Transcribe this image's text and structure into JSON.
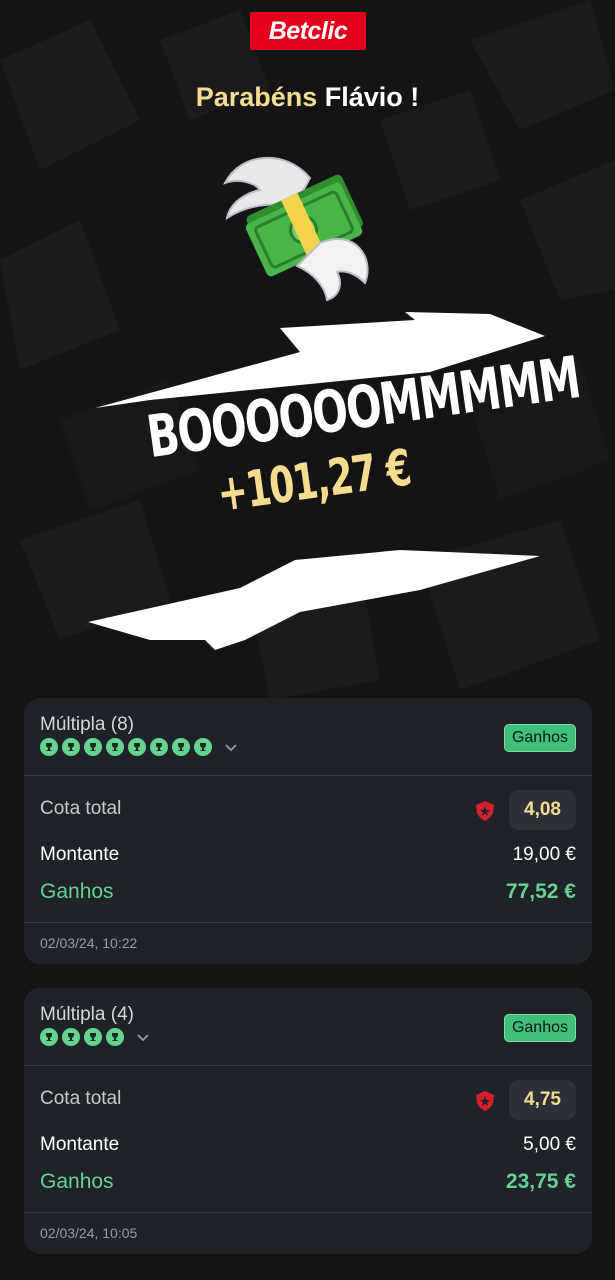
{
  "brand": {
    "logo_text": "Betclic",
    "color": "#e3001b"
  },
  "greeting": {
    "prefix": "Parabéns",
    "name": "Flávio !"
  },
  "celebration": {
    "headline": "BOOOOOOMMMMM",
    "amount": "+101,27 €"
  },
  "bets": [
    {
      "title": "Múltipla (8)",
      "selections_won": 8,
      "status": "Ganhos",
      "cota_label": "Cota total",
      "cota_value": "4,08",
      "montante_label": "Montante",
      "montante_value": "19,00 €",
      "ganhos_label": "Ganhos",
      "ganhos_value": "77,52 €",
      "timestamp": "02/03/24, 10:22"
    },
    {
      "title": "Múltipla (4)",
      "selections_won": 4,
      "status": "Ganhos",
      "cota_label": "Cota total",
      "cota_value": "4,75",
      "montante_label": "Montante",
      "montante_value": "5,00 €",
      "ganhos_label": "Ganhos",
      "ganhos_value": "23,75 €",
      "timestamp": "02/03/24, 10:05"
    }
  ],
  "colors": {
    "accent_gold": "#f5dc8e",
    "win_green": "#62d48e",
    "background": "#141416",
    "card": "#202229"
  },
  "icons": [
    "trophy-icon",
    "chevron-down-icon",
    "boost-shield-icon",
    "flying-money-icon"
  ]
}
